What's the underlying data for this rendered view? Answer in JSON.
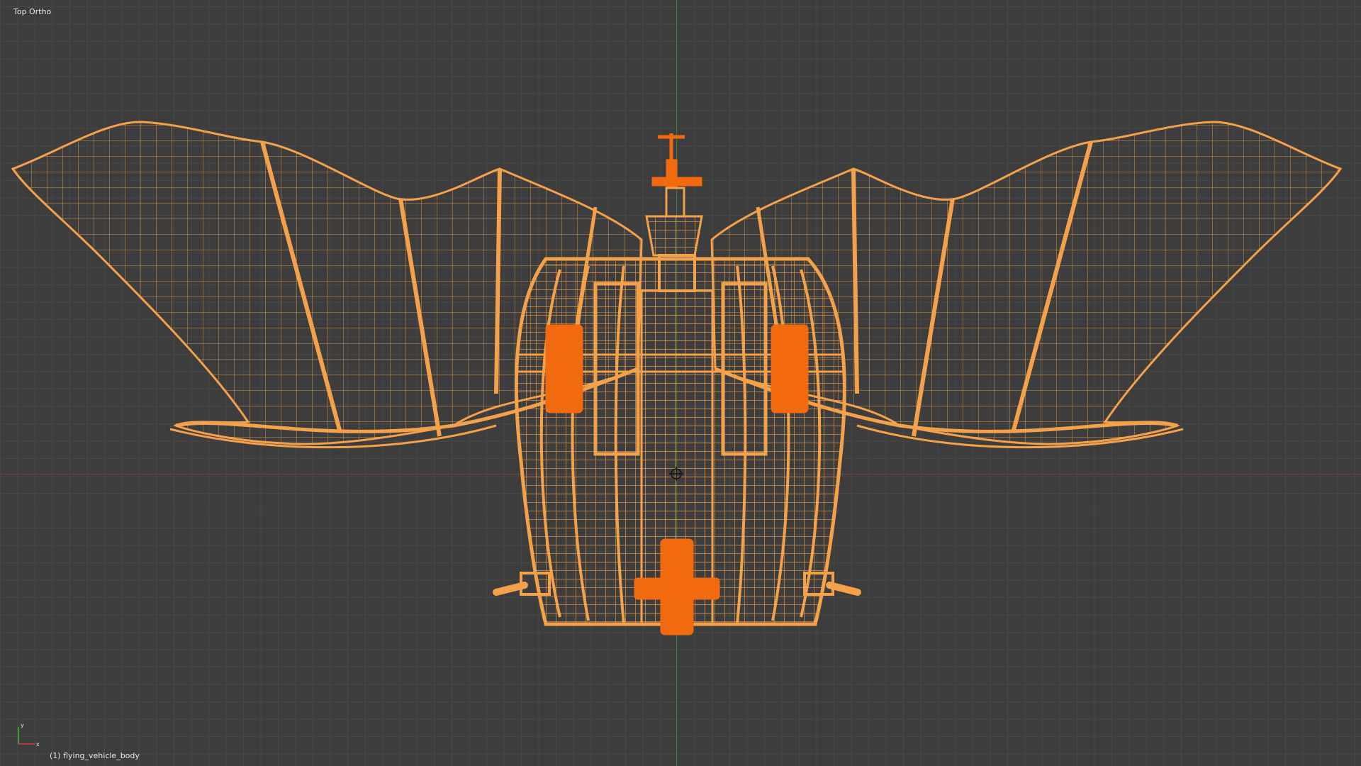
{
  "viewport": {
    "view_label": "Top Ortho",
    "object_label": "(1) flying_vehicle_body",
    "colors": {
      "background": "#3d3d3d",
      "grid": "#474747",
      "x_axis": "#7a3a3a",
      "y_axis": "#3a7a3a",
      "wireframe": "#f3a14a",
      "wireframe_selected": "#f26a10"
    },
    "icons": {
      "axis_gizmo": "xyz-axis-gizmo-icon",
      "origin": "3d-cursor-icon"
    }
  }
}
